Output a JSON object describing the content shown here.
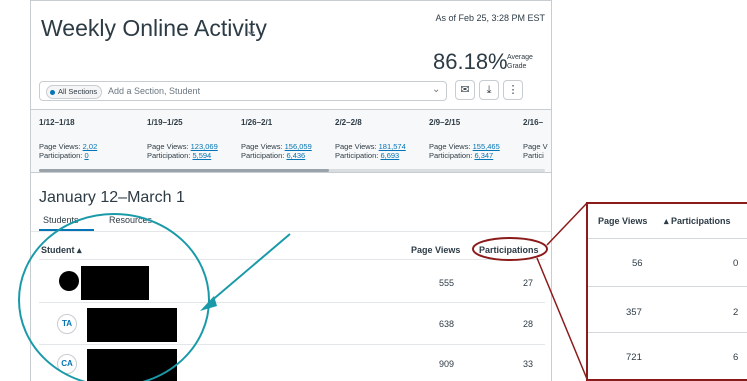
{
  "header": {
    "title": "Weekly Online Activity",
    "as_of": "As of Feb 25, 3:28 PM EST",
    "grade_pct": "86.18%",
    "grade_label_1": "Average",
    "grade_label_2": "Grade"
  },
  "filter": {
    "chip_label": "All Sections",
    "placeholder": "Add a Section, Student"
  },
  "weeks": [
    {
      "label": "1/12–1/18",
      "pv_prefix": "Page Views: ",
      "pv": "2,02",
      "pt_prefix": "Participation: ",
      "pt": "0"
    },
    {
      "label": "1/19–1/25",
      "pv_prefix": "Page Views: ",
      "pv": "123,069",
      "pt_prefix": "Participation: ",
      "pt": "5,594"
    },
    {
      "label": "1/26–2/1",
      "pv_prefix": "Page Views: ",
      "pv": "156,059",
      "pt_prefix": "Participation: ",
      "pt": "6,436"
    },
    {
      "label": "2/2–2/8",
      "pv_prefix": "Page Views: ",
      "pv": "181,574",
      "pt_prefix": "Participation: ",
      "pt": "6,693"
    },
    {
      "label": "2/9–2/15",
      "pv_prefix": "Page Views: ",
      "pv": "155,465",
      "pt_prefix": "Participation: ",
      "pt": "6,347"
    },
    {
      "label": "2/16–",
      "pv_prefix": "Page V",
      "pv": "",
      "pt_prefix": "Partici",
      "pt": ""
    }
  ],
  "range_title": "January 12–March 1",
  "tabs": [
    "Students",
    "Resources"
  ],
  "table": {
    "col_student": "Student ▴",
    "col_pageviews": "Page Views",
    "col_participations": "Participations",
    "rows": [
      {
        "avatar": "",
        "page_views": "555",
        "participations": "27"
      },
      {
        "avatar": "TA",
        "page_views": "638",
        "participations": "28"
      },
      {
        "avatar": "CA",
        "page_views": "909",
        "participations": "33"
      }
    ]
  },
  "zoom": {
    "col_pageviews": "Page Views",
    "col_participations": "▴ Participations",
    "rows": [
      {
        "page_views": "56",
        "participations": "0"
      },
      {
        "page_views": "357",
        "participations": "2"
      },
      {
        "page_views": "721",
        "participations": "6"
      }
    ]
  },
  "colors": {
    "accent": "#0374b5",
    "annotation_teal": "#1a9aa8",
    "annotation_red": "#8b1a1a"
  }
}
